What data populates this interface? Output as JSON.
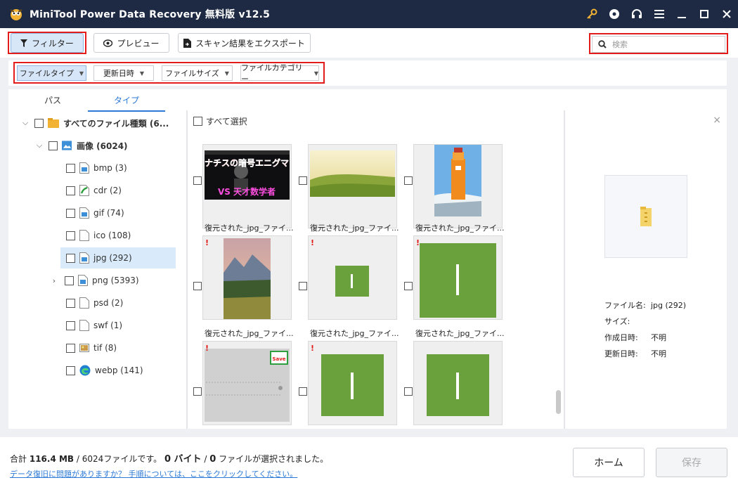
{
  "window": {
    "title": "MiniTool Power Data Recovery 無料版 v12.5"
  },
  "toolbar": {
    "filter_label": "フィルター",
    "preview_label": "プレビュー",
    "export_label": "スキャン結果をエクスポート",
    "search_placeholder": "検索",
    "search_value": ""
  },
  "filters": [
    {
      "label": "ファイルタイプ",
      "active": true
    },
    {
      "label": "更新日時",
      "active": false
    },
    {
      "label": "ファイルサイズ",
      "active": false
    },
    {
      "label": "ファイルカテゴリー",
      "active": false
    }
  ],
  "tabs": [
    {
      "label": "パス",
      "active": false
    },
    {
      "label": "タイプ",
      "active": true
    }
  ],
  "tree": {
    "root": "すべてのファイル種類 (6...",
    "images": "画像 (6024)",
    "items": [
      {
        "label": "bmp (3)",
        "icon": "image-file-icon"
      },
      {
        "label": "cdr (2)",
        "icon": "cdr-file-icon"
      },
      {
        "label": "gif (74)",
        "icon": "image-file-icon"
      },
      {
        "label": "ico (108)",
        "icon": "blank-file-icon"
      },
      {
        "label": "jpg (292)",
        "icon": "image-file-icon",
        "selected": true
      },
      {
        "label": "png (5393)",
        "icon": "image-file-icon",
        "expandable": true
      },
      {
        "label": "psd (2)",
        "icon": "blank-file-icon"
      },
      {
        "label": "swf (1)",
        "icon": "blank-file-icon"
      },
      {
        "label": "tif (8)",
        "icon": "tif-file-icon"
      },
      {
        "label": "webp (141)",
        "icon": "edge-file-icon"
      }
    ]
  },
  "grid": {
    "select_all": "すべて選択",
    "tiles": [
      {
        "caption": "復元された_jpg_ファイ...",
        "thumb": "enigma",
        "thumb_text_top": "ナチスの暗号エニグマ",
        "thumb_text_bottom": "VS 天才数学者",
        "warning": false
      },
      {
        "caption": "復元された_jpg_ファイ...",
        "thumb": "meadow",
        "warning": false
      },
      {
        "caption": "復元された_jpg_ファイ...",
        "thumb": "lighthouse",
        "warning": false
      },
      {
        "caption": "復元された_jpg_ファイ...",
        "thumb": "mountain",
        "warning": true
      },
      {
        "caption": "復元された_jpg_ファイ...",
        "thumb": "green-small",
        "warning": true
      },
      {
        "caption": "復元された_jpg_ファイ...",
        "thumb": "green-large",
        "warning": true
      },
      {
        "caption": "",
        "thumb": "grey-doc",
        "thumb_text": "Save",
        "warning": true
      },
      {
        "caption": "",
        "thumb": "green-large",
        "warning": true
      },
      {
        "caption": "",
        "thumb": "green-large",
        "warning": false
      }
    ],
    "warning_mark": "!"
  },
  "preview": {
    "close_glyph": "×",
    "filename_label": "ファイル名:",
    "filename_value": "jpg (292)",
    "size_label": "サイズ:",
    "size_value": "",
    "created_label": "作成日時:",
    "created_value": "不明",
    "modified_label": "更新日時:",
    "modified_value": "不明"
  },
  "status": {
    "total_prefix": "合計",
    "total_size": "116.4 MB",
    "total_sep": "/",
    "total_files": "6024ファイルです。",
    "selected_bytes": "0 バイト",
    "selected_sep": "/",
    "selected_files": "0",
    "selected_suffix": "ファイルが選択されました。",
    "help_link": "データ復旧に問題がありますか？ 手順については、ここをクリックしてください。"
  },
  "actions": {
    "home_label": "ホーム",
    "save_label": "保存"
  },
  "colors": {
    "titlebar": "#1e2a44",
    "accent": "#2d7ad6",
    "highlight_box": "#e21b1b",
    "thumb_green": "#6aa13c"
  }
}
